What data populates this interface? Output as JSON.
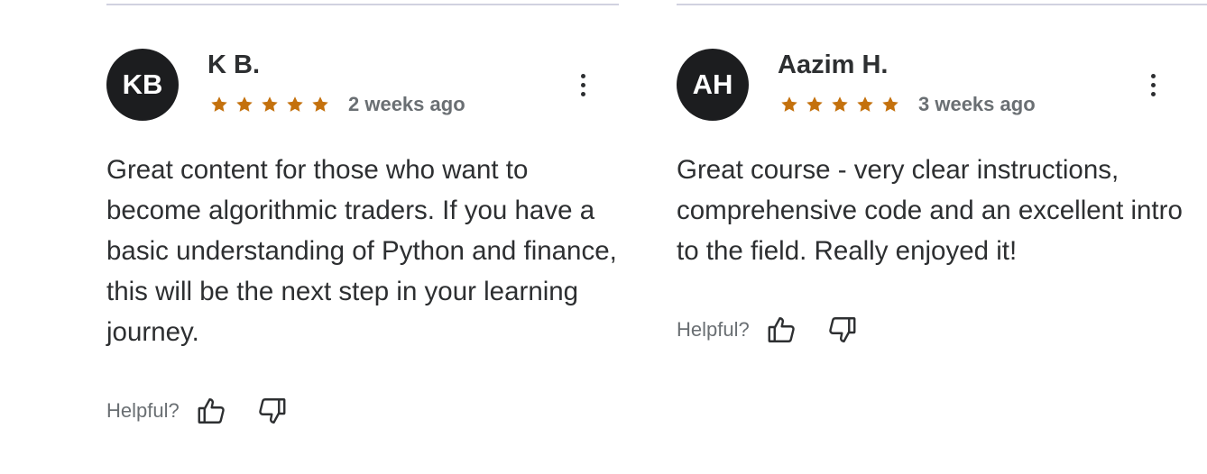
{
  "reviews": [
    {
      "initials": "KB",
      "name": "K B.",
      "rating": 5,
      "time": "2 weeks ago",
      "text": "Great content for those who want to become algorithmic traders. If you have a basic understanding of Python and finance, this will be the next step in your learning journey.",
      "helpful_label": "Helpful?"
    },
    {
      "initials": "AH",
      "name": "Aazim H.",
      "rating": 5,
      "time": "3 weeks ago",
      "text": "Great course - very clear instructions, comprehensive code and an excellent intro to the field. Really enjoyed it!",
      "helpful_label": "Helpful?"
    }
  ],
  "colors": {
    "star": "#c4710d",
    "avatar_bg": "#1c1d1f",
    "text": "#2d2f31",
    "muted": "#6a6f73",
    "divider": "#d1d2e0"
  },
  "icons": {
    "star": "star-icon",
    "more": "more-vertical-icon",
    "thumbs_up": "thumbs-up-icon",
    "thumbs_down": "thumbs-down-icon"
  }
}
